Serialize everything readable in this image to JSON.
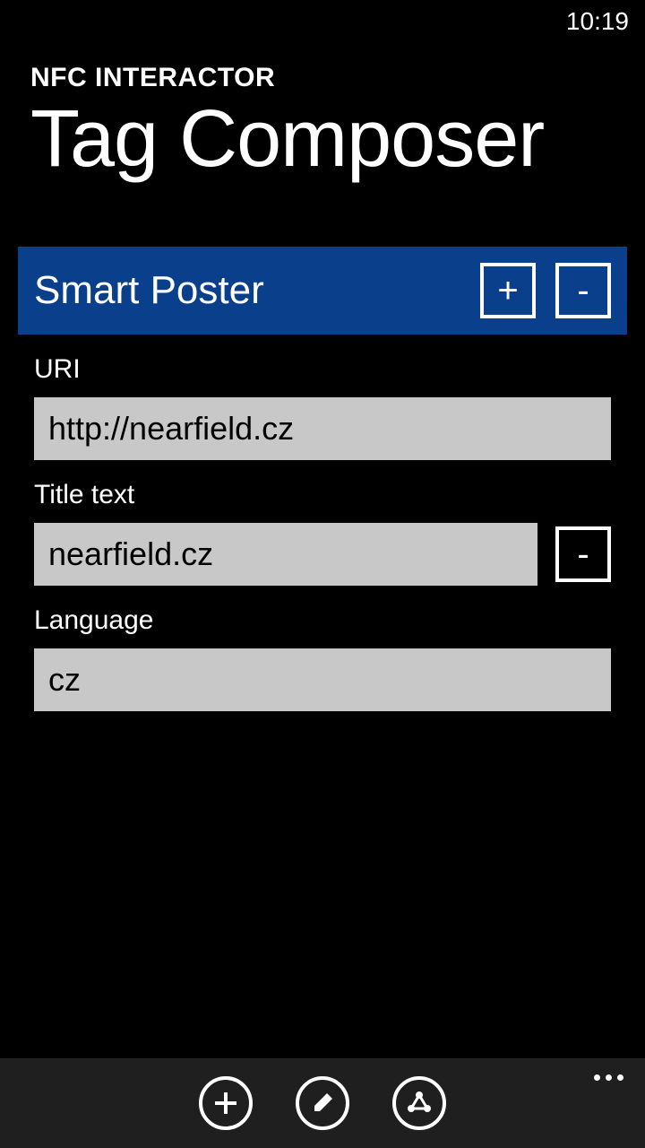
{
  "status": {
    "time": "10:19"
  },
  "header": {
    "app_title": "NFC INTERACTOR",
    "page_title": "Tag Composer"
  },
  "section": {
    "title": "Smart Poster",
    "add_label": "+",
    "remove_label": "-"
  },
  "form": {
    "uri": {
      "label": "URI",
      "value": "http://nearfield.cz"
    },
    "title_text": {
      "label": "Title text",
      "value": "nearfield.cz",
      "remove_label": "-"
    },
    "language": {
      "label": "Language",
      "value": "cz"
    }
  }
}
